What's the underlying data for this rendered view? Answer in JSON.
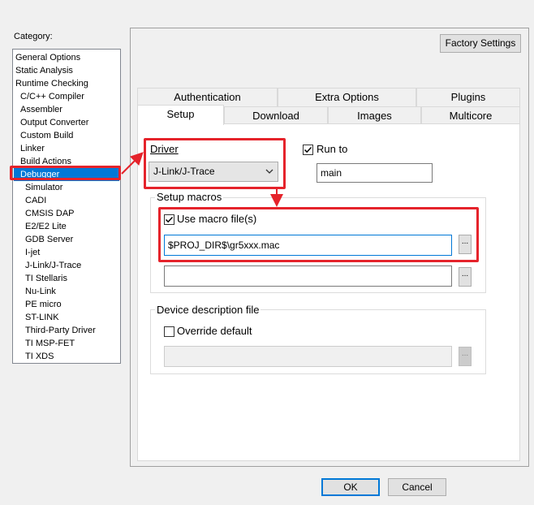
{
  "category": {
    "label": "Category:",
    "items": [
      {
        "label": "General Options"
      },
      {
        "label": "Static Analysis"
      },
      {
        "label": "Runtime Checking"
      },
      {
        "label": "C/C++ Compiler"
      },
      {
        "label": "Assembler"
      },
      {
        "label": "Output Converter"
      },
      {
        "label": "Custom Build"
      },
      {
        "label": "Linker"
      },
      {
        "label": "Build Actions"
      },
      {
        "label": "Debugger"
      },
      {
        "label": "Simulator"
      },
      {
        "label": "CADI"
      },
      {
        "label": "CMSIS DAP"
      },
      {
        "label": "E2/E2 Lite"
      },
      {
        "label": "GDB Server"
      },
      {
        "label": "I-jet"
      },
      {
        "label": "J-Link/J-Trace"
      },
      {
        "label": "TI Stellaris"
      },
      {
        "label": "Nu-Link"
      },
      {
        "label": "PE micro"
      },
      {
        "label": "ST-LINK"
      },
      {
        "label": "Third-Party Driver"
      },
      {
        "label": "TI MSP-FET"
      },
      {
        "label": "TI XDS"
      }
    ],
    "selected": "Debugger"
  },
  "factory_settings_label": "Factory Settings",
  "tabs_row1": [
    "Authentication",
    "Extra Options",
    "Plugins"
  ],
  "tabs_row2": [
    "Setup",
    "Download",
    "Images",
    "Multicore"
  ],
  "active_tab": "Setup",
  "setup": {
    "driver_label": "Driver",
    "driver_value": "J-Link/J-Trace",
    "run_to_label": "Run to",
    "run_to_checked": true,
    "run_to_value": "main",
    "setup_macros_label": "Setup macros",
    "use_macro_label": "Use macro file(s)",
    "use_macro_checked": true,
    "macro_file_1": "$PROJ_DIR$\\gr5xxx.mac",
    "macro_file_2": "",
    "browse_label": "...",
    "device_desc_label": "Device description file",
    "override_label": "Override default",
    "override_checked": false,
    "device_file": ""
  },
  "ok_label": "OK",
  "cancel_label": "Cancel",
  "colors": {
    "highlight": "#e5232b",
    "selection": "#0078d7"
  }
}
